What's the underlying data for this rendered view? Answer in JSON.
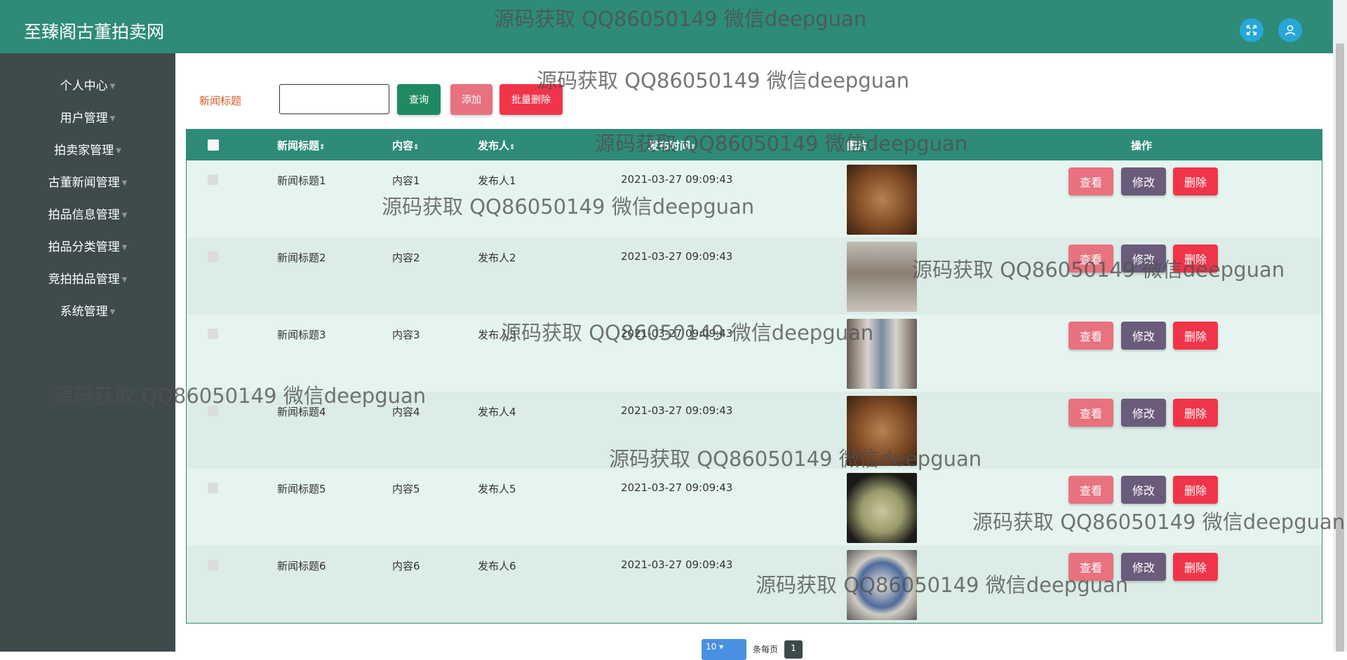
{
  "header": {
    "title": "至臻阁古董拍卖网"
  },
  "sidebar": {
    "items": [
      {
        "label": "个人中心"
      },
      {
        "label": "用户管理"
      },
      {
        "label": "拍卖家管理"
      },
      {
        "label": "古董新闻管理"
      },
      {
        "label": "拍品信息管理"
      },
      {
        "label": "拍品分类管理"
      },
      {
        "label": "竞拍拍品管理"
      },
      {
        "label": "系统管理"
      }
    ]
  },
  "search": {
    "label": "新闻标题",
    "value": "",
    "query_btn": "查询",
    "add_btn": "添加",
    "batch_delete_btn": "批量删除"
  },
  "table": {
    "headers": {
      "title": "新闻标题",
      "content": "内容",
      "publisher": "发布人",
      "time": "发布时间",
      "image": "图片",
      "actions": "操作"
    },
    "rows": [
      {
        "title": "新闻标题1",
        "content": "内容1",
        "publisher": "发布人1",
        "time": "2021-03-27 09:09:43"
      },
      {
        "title": "新闻标题2",
        "content": "内容2",
        "publisher": "发布人2",
        "time": "2021-03-27 09:09:43"
      },
      {
        "title": "新闻标题3",
        "content": "内容3",
        "publisher": "发布人3",
        "time": "2021-03-27 09:09:43"
      },
      {
        "title": "新闻标题4",
        "content": "内容4",
        "publisher": "发布人4",
        "time": "2021-03-27 09:09:43"
      },
      {
        "title": "新闻标题5",
        "content": "内容5",
        "publisher": "发布人5",
        "time": "2021-03-27 09:09:43"
      },
      {
        "title": "新闻标题6",
        "content": "内容6",
        "publisher": "发布人6",
        "time": "2021-03-27 09:09:43"
      }
    ],
    "view_btn": "查看",
    "edit_btn": "修改",
    "delete_btn": "删除"
  },
  "pagination": {
    "page_size": "10",
    "per_page_label": "条每页",
    "current_page": "1"
  },
  "watermark": "源码获取 QQ86050149 微信deepguan",
  "colors": {
    "primary": "#2e8b77",
    "sidebar": "#3f4a4c",
    "view": "#e8727f",
    "edit": "#6b5b7b",
    "delete": "#f0354a"
  },
  "icons": [
    "fullscreen-icon",
    "user-icon"
  ]
}
